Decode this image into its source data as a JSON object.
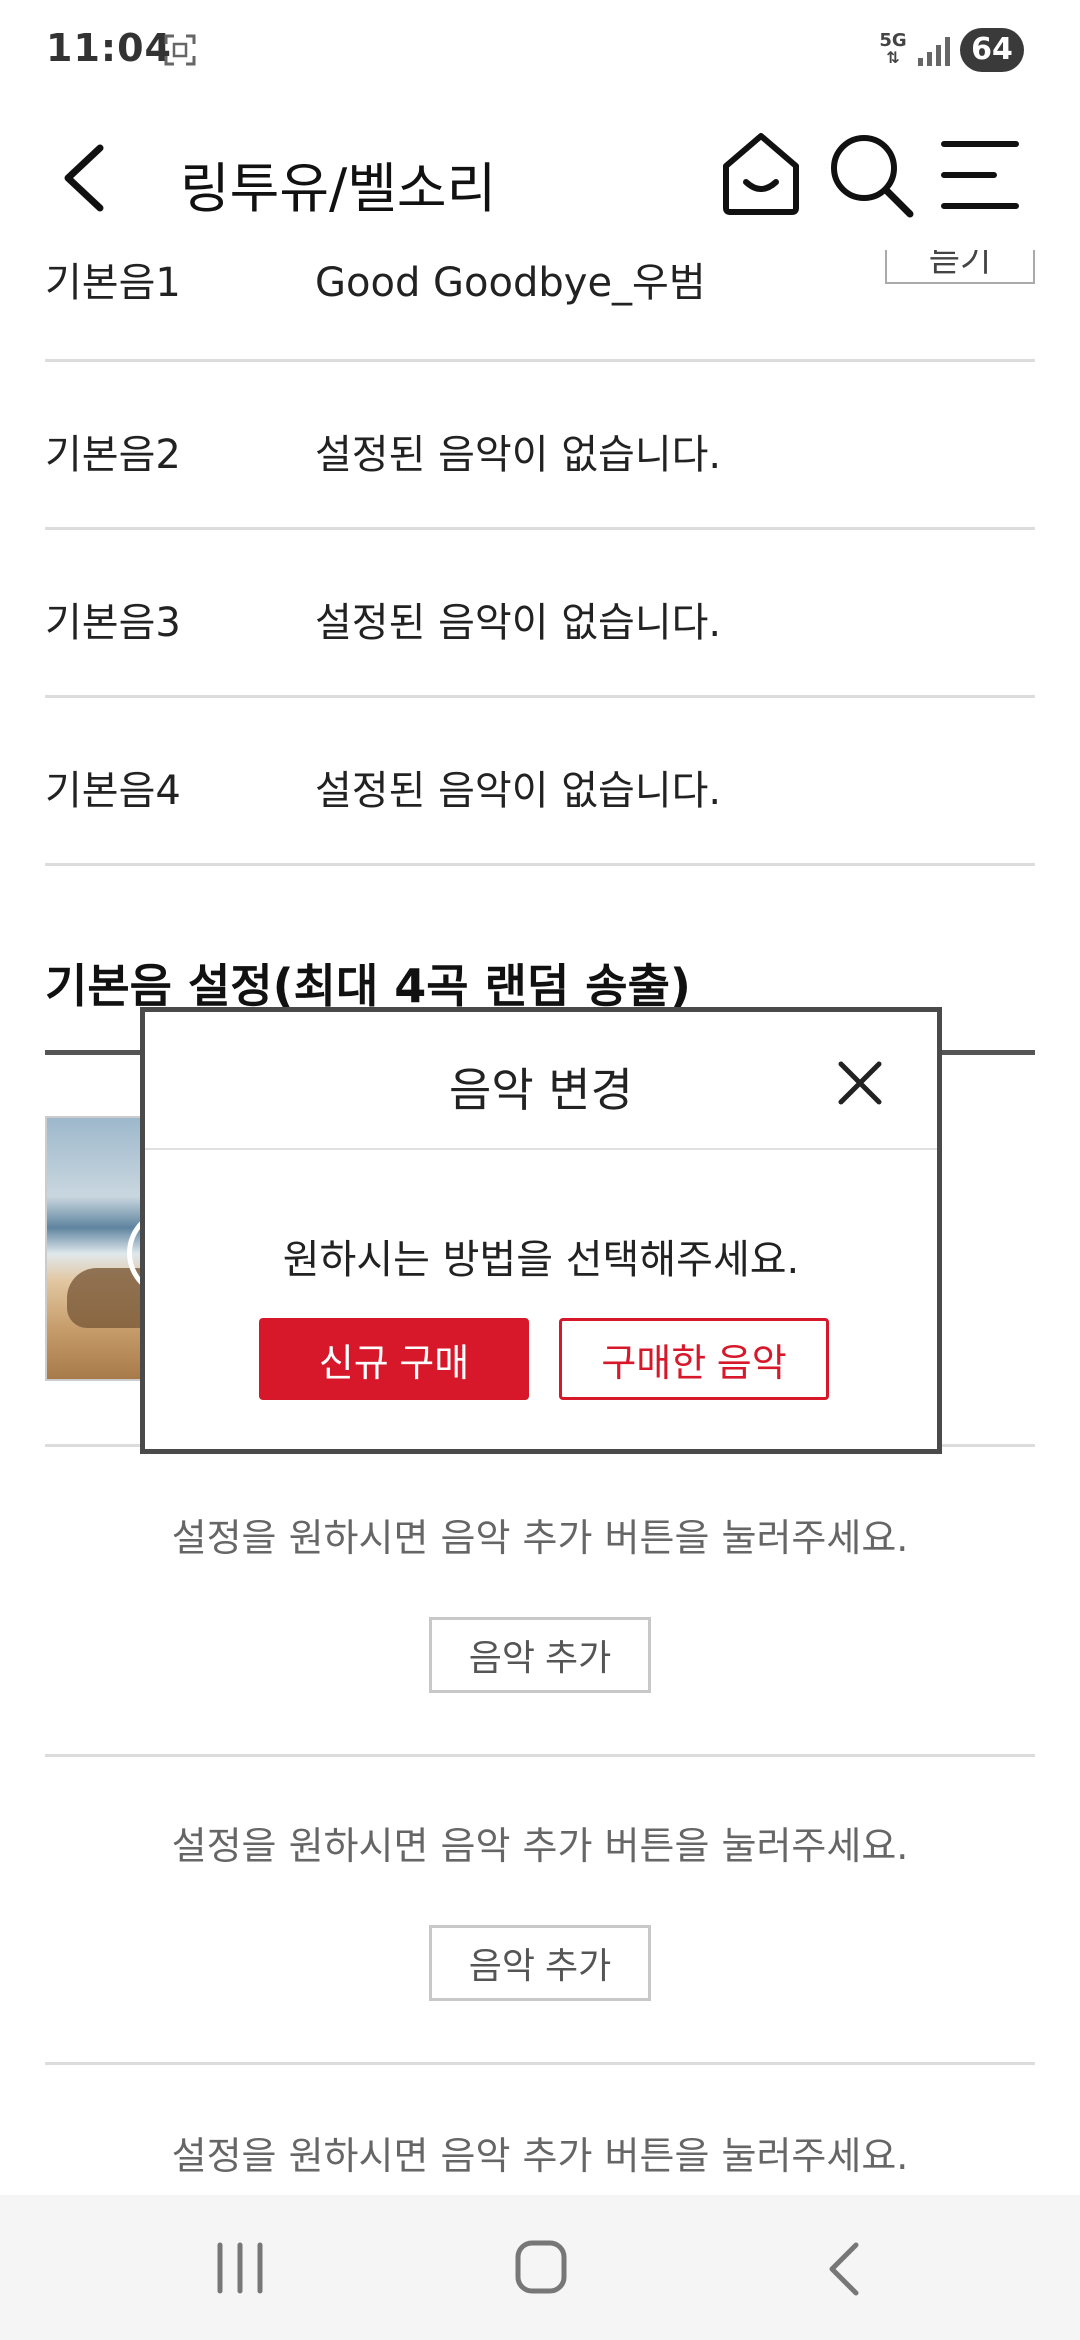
{
  "status_bar": {
    "time": "11:04",
    "network": "5G",
    "battery": "64"
  },
  "header": {
    "title": "링투유/벨소리"
  },
  "ringtone_rows": [
    {
      "label": "기본음1",
      "value": "Good Goodbye_우범",
      "button": "듣기"
    },
    {
      "label": "기본음2",
      "value": "설정된 음악이 없습니다."
    },
    {
      "label": "기본음3",
      "value": "설정된 음악이 없습니다."
    },
    {
      "label": "기본음4",
      "value": "설정된 음악이 없습니다."
    }
  ],
  "section": {
    "title": "기본음 설정(최대 4곡 랜덤 송출)"
  },
  "slots": [
    {
      "message": "설정을 원하시면 음악 추가 버튼을 눌러주세요.",
      "button": "음악 추가"
    },
    {
      "message": "설정을 원하시면 음악 추가 버튼을 눌러주세요.",
      "button": "음악 추가"
    },
    {
      "message": "설정을 원하시면 음악 추가 버튼을 눌러주세요."
    }
  ],
  "modal": {
    "title": "음악 변경",
    "message": "원하시는 방법을 선택해주세요.",
    "primary_button": "신규 구매",
    "secondary_button": "구매한 음악"
  },
  "colors": {
    "accent": "#d7182a",
    "modal_border": "#4a4a4a",
    "nav_bg": "#f5f5f5"
  },
  "icons": [
    "screenshot-icon",
    "signal-icon",
    "back-arrow-icon",
    "home-icon",
    "search-icon",
    "menu-icon",
    "close-icon",
    "play-icon",
    "nav-recent-icon",
    "nav-home-icon",
    "nav-back-icon"
  ]
}
